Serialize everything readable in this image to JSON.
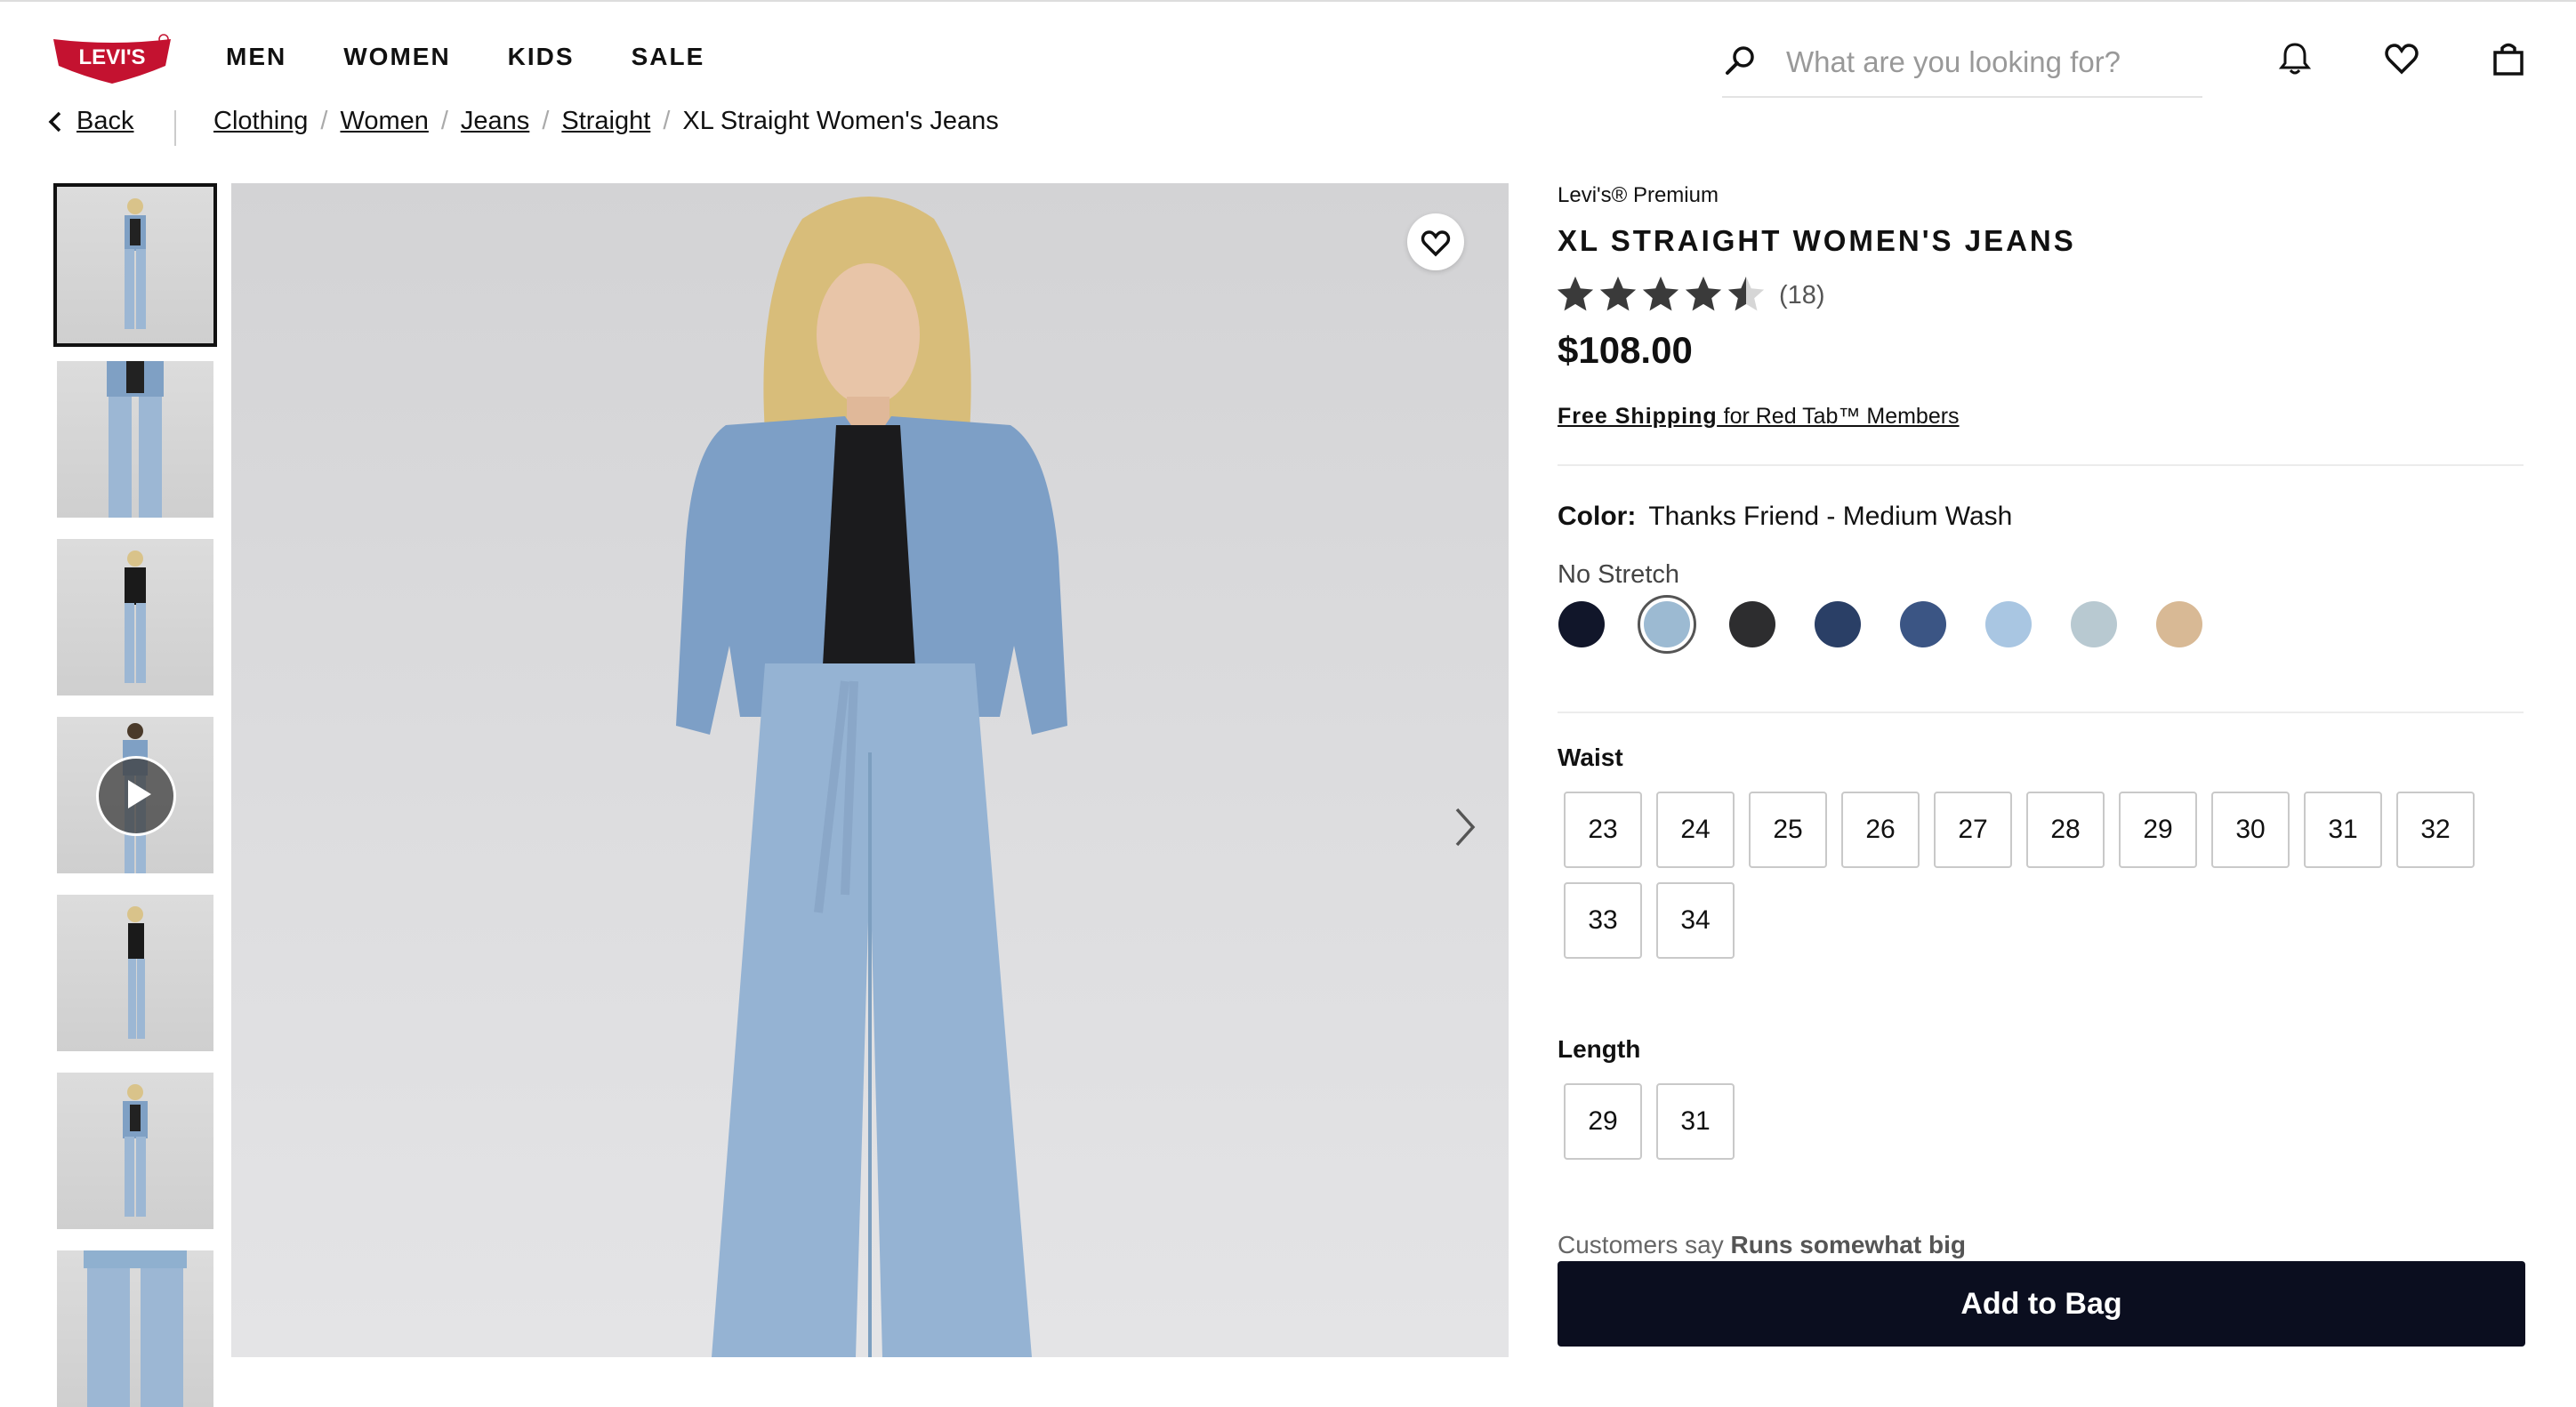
{
  "header": {
    "logo_text": "LEVI'S",
    "nav": [
      "MEN",
      "WOMEN",
      "KIDS",
      "SALE"
    ],
    "search_placeholder": "What are you looking for?",
    "icons": [
      "search-icon",
      "bell-icon",
      "heart-icon",
      "bag-icon"
    ]
  },
  "breadcrumb": {
    "back": "Back",
    "items": [
      "Clothing",
      "Women",
      "Jeans",
      "Straight"
    ],
    "current": "XL Straight Women's Jeans",
    "separator": "/"
  },
  "product": {
    "brand": "Levi's® Premium",
    "title": "XL STRAIGHT WOMEN'S JEANS",
    "rating": 4.5,
    "review_count": "(18)",
    "price": "$108.00",
    "shipping_bold": "Free Shipping",
    "shipping_rest": " for Red Tab™ Members",
    "color_label": "Color:",
    "color_value": "Thanks Friend - Medium Wash",
    "stretch": "No Stretch",
    "swatches": [
      {
        "color": "#11162a",
        "selected": false
      },
      {
        "color": "#9cbad2",
        "selected": true
      },
      {
        "color": "#2d2d2f",
        "selected": false
      },
      {
        "color": "#2a3f66",
        "selected": false
      },
      {
        "color": "#3b5584",
        "selected": false
      },
      {
        "color": "#a9c6e2",
        "selected": false
      },
      {
        "color": "#b8c9d1",
        "selected": false
      },
      {
        "color": "#d8b995",
        "selected": false
      }
    ],
    "waist_label": "Waist",
    "waist_sizes": [
      "23",
      "24",
      "25",
      "26",
      "27",
      "28",
      "29",
      "30",
      "31",
      "32",
      "33",
      "34"
    ],
    "length_label": "Length",
    "length_sizes": [
      "29",
      "31"
    ],
    "customers_say": "Customers say ",
    "customers_say_bold": "Runs somewhat big",
    "add_to_bag": "Add to Bag"
  },
  "gallery": {
    "thumb_count": 7,
    "active_index": 0,
    "video_index": 3
  },
  "colors": {
    "accent_red": "#c41230",
    "button_dark": "#0b0e1f"
  }
}
